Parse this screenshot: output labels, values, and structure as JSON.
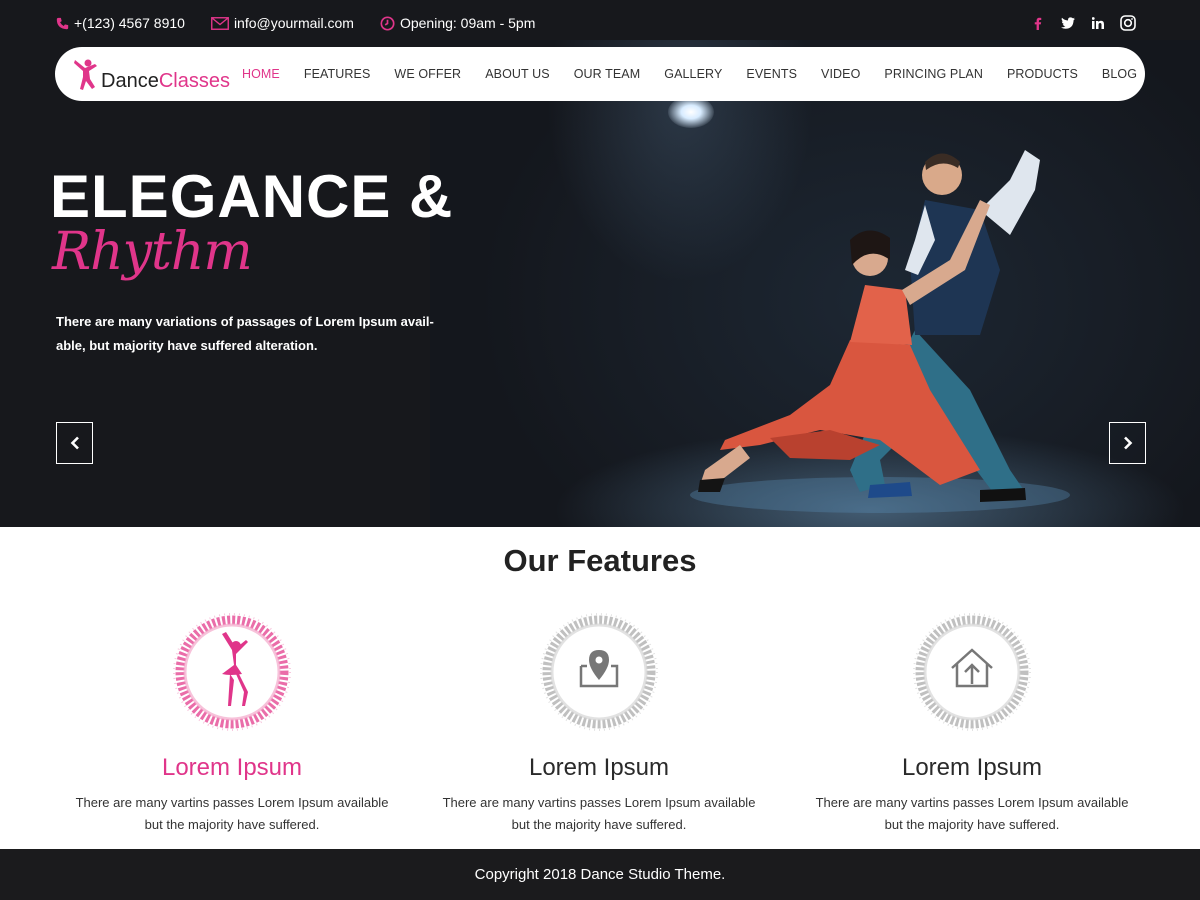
{
  "topbar": {
    "phone": "+(123) 4567 8910",
    "email": "info@yourmail.com",
    "hours": "Opening: 09am - 5pm",
    "socials": [
      "facebook-icon",
      "twitter-icon",
      "linkedin-icon",
      "instagram-icon"
    ]
  },
  "brand": {
    "name_part1": "Dance",
    "name_part2": "Classes"
  },
  "nav": {
    "items": [
      {
        "label": "HOME",
        "active": true
      },
      {
        "label": "FEATURES"
      },
      {
        "label": "WE OFFER"
      },
      {
        "label": "ABOUT US"
      },
      {
        "label": "OUR TEAM"
      },
      {
        "label": "GALLERY"
      },
      {
        "label": "EVENTS"
      },
      {
        "label": "VIDEO"
      },
      {
        "label": "PRINCING PLAN"
      },
      {
        "label": "PRODUCTS"
      },
      {
        "label": "BLOG"
      }
    ]
  },
  "hero": {
    "title": "ELEGANCE &",
    "script": "Rhythm",
    "description": "There are many variations of passages of Lorem Ipsum avail-able, but majority have suffered alteration."
  },
  "features": {
    "heading_light": "Our",
    "heading_bold": "Features",
    "items": [
      {
        "title": "Lorem Ipsum",
        "description": "There are many vartins passes Lorem Ipsum available but the majority have suffered.",
        "icon": "ballerina-icon"
      },
      {
        "title": "Lorem Ipsum",
        "description": "There are many vartins passes Lorem Ipsum available but the majority have suffered.",
        "icon": "location-pin-icon"
      },
      {
        "title": "Lorem Ipsum",
        "description": "There are many vartins passes Lorem Ipsum available but the majority have suffered.",
        "icon": "home-upload-icon"
      }
    ]
  },
  "footer": {
    "copyright": "Copyright 2018 Dance Studio Theme."
  },
  "colors": {
    "accent": "#e0358a",
    "hero_bg": "#17181c",
    "footer_bg": "#1b1b1d"
  }
}
